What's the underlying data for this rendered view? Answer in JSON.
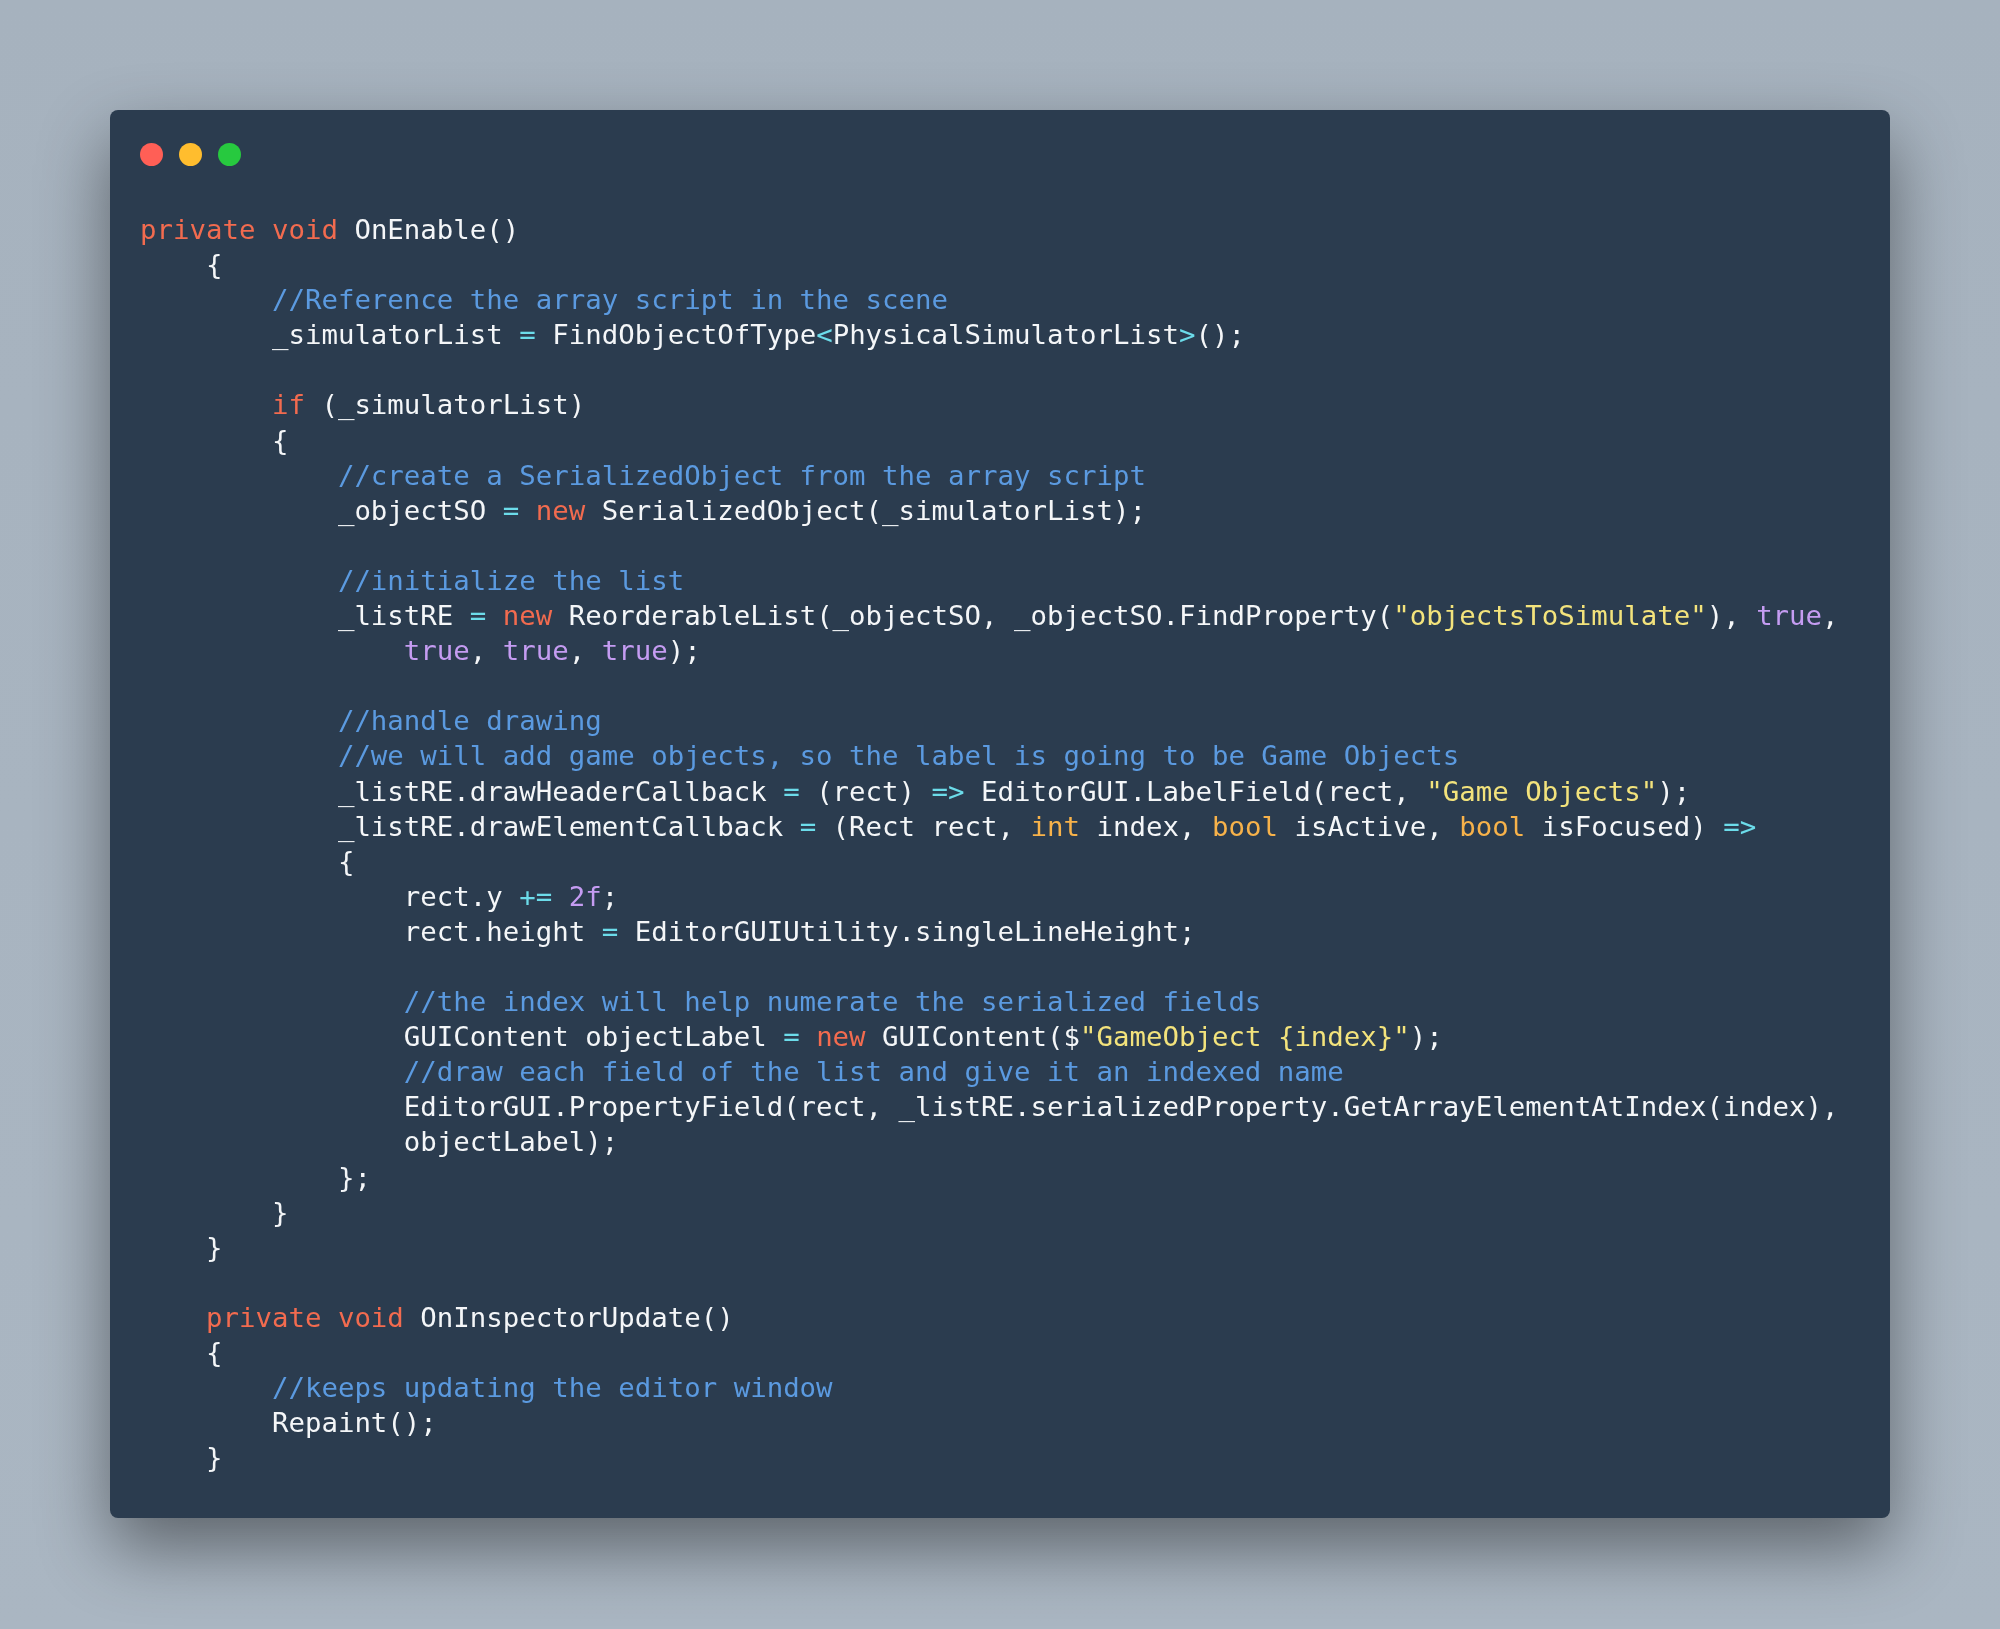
{
  "code_lines": [
    {
      "kind": "code",
      "tokens": [
        {
          "kind": "keyword",
          "text": "private void "
        },
        {
          "kind": "plain",
          "text": "OnEnable()"
        }
      ]
    },
    {
      "kind": "code",
      "tokens": [
        {
          "kind": "plain",
          "text": "    {"
        }
      ]
    },
    {
      "kind": "code",
      "tokens": [
        {
          "kind": "comment",
          "text": "        //Reference the array script in the scene"
        }
      ]
    },
    {
      "kind": "code",
      "tokens": [
        {
          "kind": "plain",
          "text": "        _simulatorList "
        },
        {
          "kind": "operator",
          "text": "="
        },
        {
          "kind": "plain",
          "text": " FindObjectOfType"
        },
        {
          "kind": "operator",
          "text": "<"
        },
        {
          "kind": "plain",
          "text": "PhysicalSimulatorList"
        },
        {
          "kind": "operator",
          "text": ">"
        },
        {
          "kind": "plain",
          "text": "();"
        }
      ]
    },
    {
      "kind": "blank"
    },
    {
      "kind": "code",
      "tokens": [
        {
          "kind": "keyword",
          "text": "        if"
        },
        {
          "kind": "plain",
          "text": " (_simulatorList)"
        }
      ]
    },
    {
      "kind": "code",
      "tokens": [
        {
          "kind": "plain",
          "text": "        {"
        }
      ]
    },
    {
      "kind": "code",
      "tokens": [
        {
          "kind": "comment",
          "text": "            //create a SerializedObject from the array script"
        }
      ]
    },
    {
      "kind": "code",
      "tokens": [
        {
          "kind": "plain",
          "text": "            _objectSO "
        },
        {
          "kind": "operator",
          "text": "= "
        },
        {
          "kind": "keyword",
          "text": "new"
        },
        {
          "kind": "plain",
          "text": " SerializedObject(_simulatorList);"
        }
      ]
    },
    {
      "kind": "blank"
    },
    {
      "kind": "code",
      "tokens": [
        {
          "kind": "comment",
          "text": "            //initialize the list"
        }
      ]
    },
    {
      "kind": "code",
      "tokens": [
        {
          "kind": "plain",
          "text": "            _listRE "
        },
        {
          "kind": "operator",
          "text": "= "
        },
        {
          "kind": "keyword",
          "text": "new"
        },
        {
          "kind": "plain",
          "text": " ReorderableList(_objectSO, _objectSO.FindProperty("
        },
        {
          "kind": "string",
          "text": "\"objectsToSimulate\""
        },
        {
          "kind": "plain",
          "text": "), "
        },
        {
          "kind": "literal",
          "text": "true"
        },
        {
          "kind": "plain",
          "text": ","
        }
      ]
    },
    {
      "kind": "code",
      "tokens": [
        {
          "kind": "literal",
          "text": "                true"
        },
        {
          "kind": "plain",
          "text": ", "
        },
        {
          "kind": "literal",
          "text": "true"
        },
        {
          "kind": "plain",
          "text": ", "
        },
        {
          "kind": "literal",
          "text": "true"
        },
        {
          "kind": "plain",
          "text": ");"
        }
      ]
    },
    {
      "kind": "blank"
    },
    {
      "kind": "code",
      "tokens": [
        {
          "kind": "comment",
          "text": "            //handle drawing"
        }
      ]
    },
    {
      "kind": "code",
      "tokens": [
        {
          "kind": "comment",
          "text": "            //we will add game objects, so the label is going to be Game Objects"
        }
      ]
    },
    {
      "kind": "code",
      "tokens": [
        {
          "kind": "plain",
          "text": "            _listRE.drawHeaderCallback "
        },
        {
          "kind": "operator",
          "text": "="
        },
        {
          "kind": "plain",
          "text": " (rect) "
        },
        {
          "kind": "operator",
          "text": "=>"
        },
        {
          "kind": "plain",
          "text": " EditorGUI.LabelField(rect, "
        },
        {
          "kind": "string",
          "text": "\"Game Objects\""
        },
        {
          "kind": "plain",
          "text": ");"
        }
      ]
    },
    {
      "kind": "code",
      "tokens": [
        {
          "kind": "plain",
          "text": "            _listRE.drawElementCallback "
        },
        {
          "kind": "operator",
          "text": "="
        },
        {
          "kind": "plain",
          "text": " (Rect rect, "
        },
        {
          "kind": "type",
          "text": "int"
        },
        {
          "kind": "plain",
          "text": " index, "
        },
        {
          "kind": "type",
          "text": "bool"
        },
        {
          "kind": "plain",
          "text": " isActive, "
        },
        {
          "kind": "type",
          "text": "bool"
        },
        {
          "kind": "plain",
          "text": " isFocused) "
        },
        {
          "kind": "operator",
          "text": "=>"
        }
      ]
    },
    {
      "kind": "code",
      "tokens": [
        {
          "kind": "plain",
          "text": "            {"
        }
      ]
    },
    {
      "kind": "code",
      "tokens": [
        {
          "kind": "plain",
          "text": "                rect.y "
        },
        {
          "kind": "operator",
          "text": "+= "
        },
        {
          "kind": "literal",
          "text": "2f"
        },
        {
          "kind": "plain",
          "text": ";"
        }
      ]
    },
    {
      "kind": "code",
      "tokens": [
        {
          "kind": "plain",
          "text": "                rect.height "
        },
        {
          "kind": "operator",
          "text": "="
        },
        {
          "kind": "plain",
          "text": " EditorGUIUtility.singleLineHeight;"
        }
      ]
    },
    {
      "kind": "blank"
    },
    {
      "kind": "code",
      "tokens": [
        {
          "kind": "comment",
          "text": "                //the index will help numerate the serialized fields"
        }
      ]
    },
    {
      "kind": "code",
      "tokens": [
        {
          "kind": "plain",
          "text": "                GUIContent objectLabel "
        },
        {
          "kind": "operator",
          "text": "= "
        },
        {
          "kind": "keyword",
          "text": "new"
        },
        {
          "kind": "plain",
          "text": " GUIContent($"
        },
        {
          "kind": "string",
          "text": "\"GameObject {index}\""
        },
        {
          "kind": "plain",
          "text": ");"
        }
      ]
    },
    {
      "kind": "code",
      "tokens": [
        {
          "kind": "comment",
          "text": "                //draw each field of the list and give it an indexed name"
        }
      ]
    },
    {
      "kind": "code",
      "tokens": [
        {
          "kind": "plain",
          "text": "                EditorGUI.PropertyField(rect, _listRE.serializedProperty.GetArrayElementAtIndex(index),"
        }
      ]
    },
    {
      "kind": "code",
      "tokens": [
        {
          "kind": "plain",
          "text": "                objectLabel);"
        }
      ]
    },
    {
      "kind": "code",
      "tokens": [
        {
          "kind": "plain",
          "text": "            };"
        }
      ]
    },
    {
      "kind": "code",
      "tokens": [
        {
          "kind": "plain",
          "text": "        }"
        }
      ]
    },
    {
      "kind": "code",
      "tokens": [
        {
          "kind": "plain",
          "text": "    }"
        }
      ]
    },
    {
      "kind": "blank"
    },
    {
      "kind": "code",
      "tokens": [
        {
          "kind": "keyword",
          "text": "    private void "
        },
        {
          "kind": "plain",
          "text": "OnInspectorUpdate()"
        }
      ]
    },
    {
      "kind": "code",
      "tokens": [
        {
          "kind": "plain",
          "text": "    {"
        }
      ]
    },
    {
      "kind": "code",
      "tokens": [
        {
          "kind": "comment",
          "text": "        //keeps updating the editor window"
        }
      ]
    },
    {
      "kind": "code",
      "tokens": [
        {
          "kind": "plain",
          "text": "        Repaint();"
        }
      ]
    },
    {
      "kind": "code",
      "tokens": [
        {
          "kind": "plain",
          "text": "    }"
        }
      ]
    }
  ]
}
